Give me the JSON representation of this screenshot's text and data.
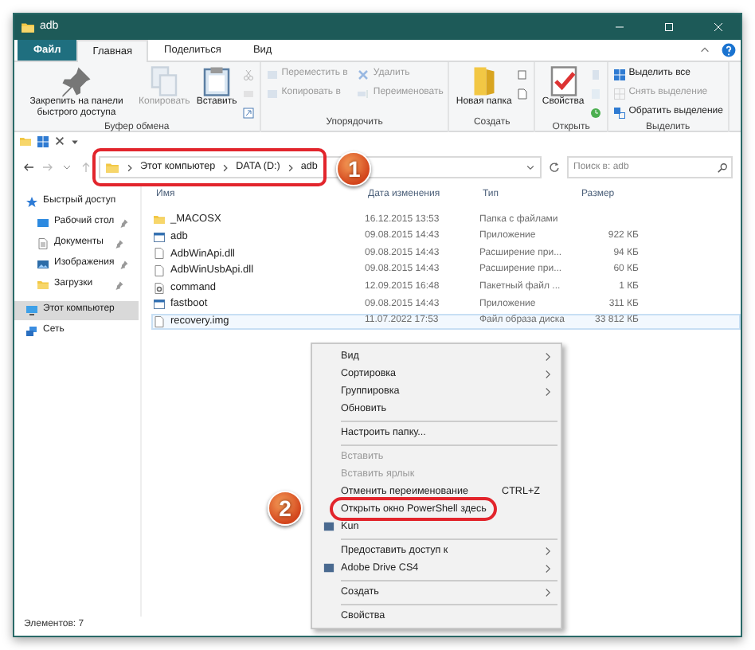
{
  "window": {
    "title": "adb"
  },
  "tabs": [
    {
      "label": "Файл",
      "kind": "file",
      "selected": false
    },
    {
      "label": "Главная",
      "kind": "tab",
      "selected": true
    },
    {
      "label": "Поделиться",
      "kind": "tab",
      "selected": false
    },
    {
      "label": "Вид",
      "kind": "tab",
      "selected": false
    }
  ],
  "ribbon": {
    "groups": [
      {
        "label": "Буфер обмена",
        "buttons": [
          {
            "label": "Закрепить на панели быстрого доступа",
            "kind": "large",
            "disabled": false
          },
          {
            "label": "Копировать",
            "kind": "large",
            "disabled": true
          },
          {
            "label": "Вставить",
            "kind": "large",
            "disabled": false
          },
          {
            "kind": "icon",
            "disabled": true
          },
          {
            "kind": "icon",
            "disabled": true
          },
          {
            "kind": "icon",
            "disabled": false
          }
        ]
      },
      {
        "label": "Упорядочить",
        "buttons": [
          {
            "label": "Переместить в",
            "kind": "small",
            "disabled": true
          },
          {
            "label": "Копировать в",
            "kind": "small",
            "disabled": true
          },
          {
            "label": "Удалить",
            "kind": "small",
            "disabled": true
          },
          {
            "label": "Переименовать",
            "kind": "small",
            "disabled": true
          }
        ]
      },
      {
        "label": "Создать",
        "buttons": [
          {
            "label": "Новая папка",
            "kind": "large",
            "disabled": false
          },
          {
            "kind": "icon",
            "disabled": false
          },
          {
            "kind": "icon",
            "disabled": false
          }
        ]
      },
      {
        "label": "Открыть",
        "buttons": [
          {
            "label": "Свойства",
            "kind": "large",
            "disabled": false
          },
          {
            "kind": "icon",
            "disabled": true
          },
          {
            "kind": "icon",
            "disabled": true
          },
          {
            "kind": "icon",
            "disabled": false
          }
        ]
      },
      {
        "label": "Выделить",
        "buttons": [
          {
            "label": "Выделить все",
            "kind": "small",
            "disabled": false
          },
          {
            "label": "Снять выделение",
            "kind": "small",
            "disabled": true
          },
          {
            "label": "Обратить выделение",
            "kind": "small",
            "disabled": false
          }
        ]
      }
    ]
  },
  "address": {
    "breadcrumbs": [
      "Этот компьютер",
      "DATA (D:)",
      "adb"
    ],
    "search_placeholder": "Поиск в: adb"
  },
  "sidebar": {
    "items": [
      {
        "label": "Быстрый доступ",
        "kind": "star",
        "selected": false,
        "children": [
          {
            "label": "Рабочий стол",
            "kind": "desktop",
            "pinned": true,
            "selected": false
          },
          {
            "label": "Документы",
            "kind": "documents",
            "pinned": true,
            "selected": false
          },
          {
            "label": "Изображения",
            "kind": "pictures",
            "pinned": true,
            "selected": false
          },
          {
            "label": "Загрузки",
            "kind": "folder",
            "pinned": true,
            "selected": false
          }
        ]
      },
      {
        "label": "Этот компьютер",
        "kind": "computer",
        "selected": true
      },
      {
        "label": "Сеть",
        "kind": "network",
        "selected": false
      }
    ]
  },
  "table": {
    "columns": [
      "Имя",
      "Дата изменения",
      "Тип",
      "Размер"
    ],
    "rows": [
      {
        "name": "_MACOSX",
        "date": "16.12.2015 13:53",
        "type": "Папка с файлами",
        "size": "",
        "kind": "folder",
        "selected": false
      },
      {
        "name": "adb",
        "date": "09.08.2015 14:43",
        "type": "Приложение",
        "size": "922 КБ",
        "kind": "application",
        "selected": false
      },
      {
        "name": "AdbWinApi.dll",
        "date": "09.08.2015 14:43",
        "type": "Расширение при...",
        "size": "94 КБ",
        "kind": "file",
        "selected": false
      },
      {
        "name": "AdbWinUsbApi.dll",
        "date": "09.08.2015 14:43",
        "type": "Расширение при...",
        "size": "60 КБ",
        "kind": "file",
        "selected": false
      },
      {
        "name": "command",
        "date": "12.09.2015 16:48",
        "type": "Пакетный файл ...",
        "size": "1 КБ",
        "kind": "script",
        "selected": false
      },
      {
        "name": "fastboot",
        "date": "09.08.2015 14:43",
        "type": "Приложение",
        "size": "311 КБ",
        "kind": "application",
        "selected": false
      },
      {
        "name": "recovery.img",
        "date": "11.07.2022 17:53",
        "type": "Файл образа диска",
        "size": "33 812 КБ",
        "kind": "file",
        "selected": true
      }
    ]
  },
  "context_menu": {
    "items": [
      {
        "kind": "item",
        "label": "Вид",
        "submenu": true,
        "disabled": false
      },
      {
        "kind": "item",
        "label": "Сортировка",
        "submenu": true,
        "disabled": false
      },
      {
        "kind": "item",
        "label": "Группировка",
        "submenu": true,
        "disabled": false
      },
      {
        "kind": "item",
        "label": "Обновить",
        "submenu": false,
        "disabled": false
      },
      {
        "kind": "separator"
      },
      {
        "kind": "item",
        "label": "Настроить папку...",
        "submenu": false,
        "disabled": false
      },
      {
        "kind": "separator"
      },
      {
        "kind": "item",
        "label": "Вставить",
        "submenu": false,
        "disabled": true
      },
      {
        "kind": "item",
        "label": "Вставить ярлык",
        "submenu": false,
        "disabled": true
      },
      {
        "kind": "item",
        "label": "Отменить переименование",
        "shortcut": "CTRL+Z",
        "submenu": false,
        "disabled": false
      },
      {
        "kind": "item",
        "label": "Открыть окно PowerShell здесь",
        "submenu": false,
        "disabled": false
      },
      {
        "kind": "item",
        "label": "Kun",
        "icon": true,
        "submenu": false,
        "disabled": false
      },
      {
        "kind": "separator"
      },
      {
        "kind": "item",
        "label": "Предоставить доступ к",
        "submenu": true,
        "disabled": false
      },
      {
        "kind": "item",
        "label": "Adobe Drive CS4",
        "icon": true,
        "submenu": true,
        "disabled": false
      },
      {
        "kind": "separator"
      },
      {
        "kind": "item",
        "label": "Создать",
        "submenu": true,
        "disabled": false
      },
      {
        "kind": "separator"
      },
      {
        "kind": "item",
        "label": "Свойства",
        "submenu": false,
        "disabled": false
      }
    ]
  },
  "status_bar": {
    "text": "Элементов: 7"
  },
  "annotations": [
    {
      "number": "1"
    },
    {
      "number": "2"
    }
  ]
}
